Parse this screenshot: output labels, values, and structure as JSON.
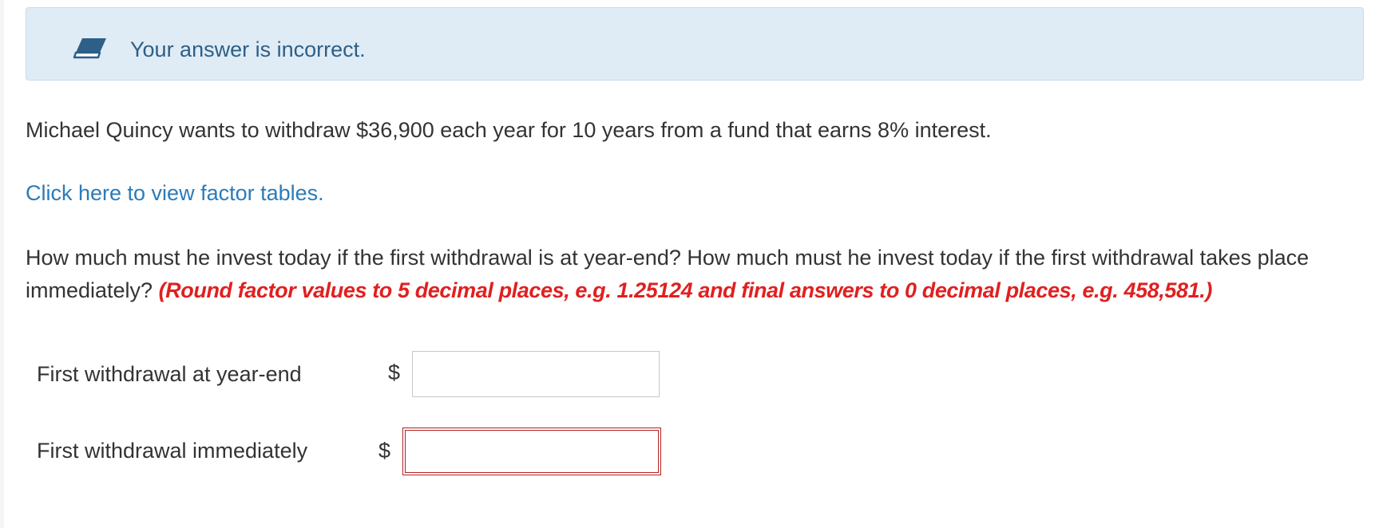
{
  "feedback": {
    "message": "Your answer is incorrect.",
    "icon": "eraser-icon"
  },
  "question": {
    "statement": "Michael Quincy wants to withdraw $36,900 each year for 10 years from a fund that earns 8% interest.",
    "factor_link": "Click here to view factor tables.",
    "prompt": "How much must he invest today if the first withdrawal is at year-end? How much must he invest today if the first withdrawal takes place immediately?",
    "instructions": "(Round factor values to 5 decimal places, e.g. 1.25124 and final answers to 0 decimal places, e.g. 458,581.)"
  },
  "answers": {
    "currency_symbol": "$",
    "rows": [
      {
        "label": "First withdrawal at year-end",
        "value": ""
      },
      {
        "label": "First withdrawal immediately",
        "value": ""
      }
    ]
  },
  "colors": {
    "alert_background": "#dfecf6",
    "alert_text": "#2e5f86",
    "link": "#2b7bb9",
    "instruction_red": "#e02020",
    "error_border": "#b52020"
  }
}
